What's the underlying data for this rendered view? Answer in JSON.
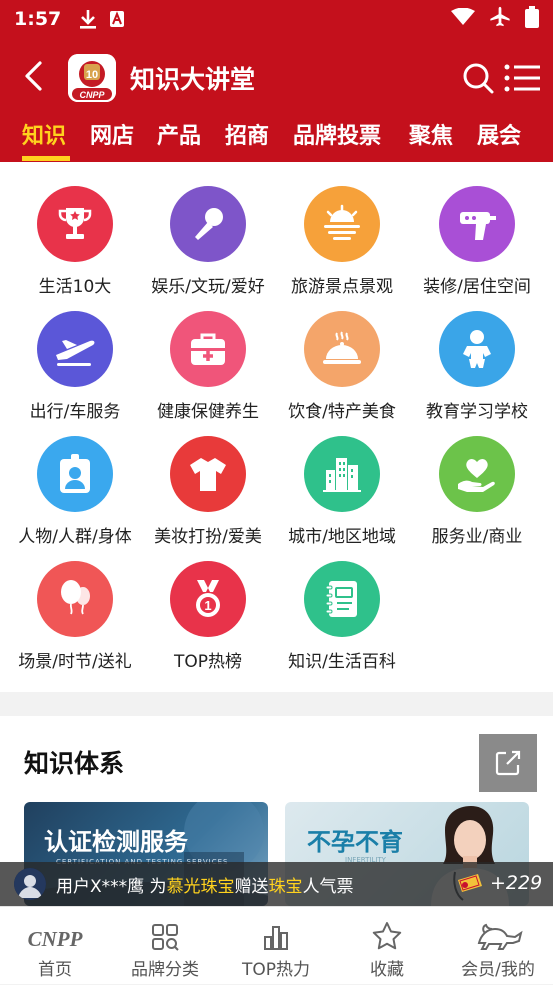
{
  "status_bar": {
    "time": "1:57"
  },
  "header": {
    "title": "知识大讲堂",
    "logo_text": "CNPP"
  },
  "tabs": [
    {
      "label": "知识",
      "active": true
    },
    {
      "label": "网店"
    },
    {
      "label": "产品"
    },
    {
      "label": "招商"
    },
    {
      "label": "品牌投票"
    },
    {
      "label": "聚焦"
    },
    {
      "label": "展会"
    }
  ],
  "categories": [
    {
      "label": "生活10大",
      "icon": "trophy-icon",
      "color": "#e8334a"
    },
    {
      "label": "娱乐/文玩/爱好",
      "icon": "microphone-icon",
      "color": "#7e55c9"
    },
    {
      "label": "旅游景点景观",
      "icon": "sunset-icon",
      "color": "#f6a13a"
    },
    {
      "label": "装修/居住空间",
      "icon": "drill-icon",
      "color": "#a94fd6"
    },
    {
      "label": "出行/车服务",
      "icon": "airplane-icon",
      "color": "#5b57d8"
    },
    {
      "label": "健康保健养生",
      "icon": "medical-kit-icon",
      "color": "#f0557a"
    },
    {
      "label": "饮食/特产美食",
      "icon": "food-cloche-icon",
      "color": "#f4a56a"
    },
    {
      "label": "教育学习学校",
      "icon": "baby-icon",
      "color": "#3aa5e8"
    },
    {
      "label": "人物/人群/身体",
      "icon": "badge-person-icon",
      "color": "#3aa8ee"
    },
    {
      "label": "美妆打扮/爱美",
      "icon": "tshirt-icon",
      "color": "#e83a3a"
    },
    {
      "label": "城市/地区地域",
      "icon": "city-icon",
      "color": "#2fc18b"
    },
    {
      "label": "服务业/商业",
      "icon": "heart-hand-icon",
      "color": "#6cc34a"
    },
    {
      "label": "场景/时节/送礼",
      "icon": "balloon-icon",
      "color": "#f05656"
    },
    {
      "label": "TOP热榜",
      "icon": "medal-icon",
      "color": "#e8334a"
    },
    {
      "label": "知识/生活百科",
      "icon": "book-icon",
      "color": "#2fc18b"
    }
  ],
  "section": {
    "title": "知识体系",
    "cards": [
      {
        "title": "认证检测服务",
        "subtitle": "CERTIFICATION AND TESTING SERVICES"
      },
      {
        "title": "不孕不育",
        "subtitle": "INFERTILITY"
      }
    ]
  },
  "ticker": {
    "prefix": "用户X***鹰 为 ",
    "brand": "慕光珠宝",
    "mid": "赠送",
    "category": "珠宝",
    "suffix": "人气票",
    "votes": "+229"
  },
  "bottom_nav": [
    {
      "label": "首页",
      "icon": "cnpp-home-icon"
    },
    {
      "label": "品牌分类",
      "icon": "category-grid-icon"
    },
    {
      "label": "TOP热力",
      "icon": "bar-chart-icon"
    },
    {
      "label": "收藏",
      "icon": "star-icon"
    },
    {
      "label": "会员/我的",
      "icon": "lion-icon"
    }
  ]
}
